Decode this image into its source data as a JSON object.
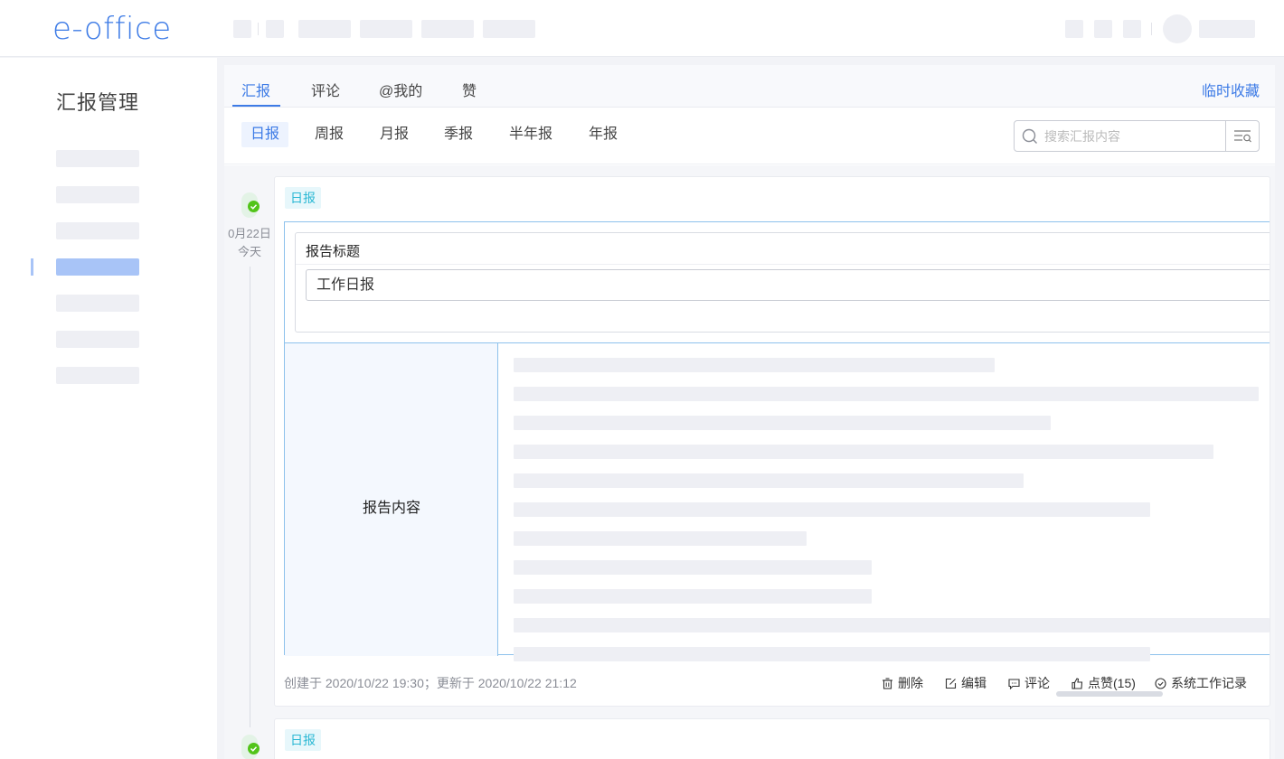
{
  "header": {
    "logo_text": "e-office"
  },
  "sidebar": {
    "title": "汇报管理"
  },
  "tabs": [
    {
      "label": "汇报"
    },
    {
      "label": "评论"
    },
    {
      "label": "@我的"
    },
    {
      "label": "赞"
    }
  ],
  "fav_link": "临时收藏",
  "subtabs": [
    {
      "label": "日报"
    },
    {
      "label": "周报"
    },
    {
      "label": "月报"
    },
    {
      "label": "季报"
    },
    {
      "label": "半年报"
    },
    {
      "label": "年报"
    }
  ],
  "search": {
    "placeholder": "搜索汇报内容"
  },
  "timeline": {
    "date": "0月22日",
    "day": "今天"
  },
  "report": {
    "tag": "日报",
    "title_label": "报告标题",
    "title_value": "工作日报",
    "content_label": "报告内容",
    "meta": "创建于 2020/10/22 19:30；更新于 2020/10/22 21:12",
    "actions": {
      "delete": "删除",
      "edit": "编辑",
      "comment": "评论",
      "like": "点赞(15)",
      "log": "系统工作记录"
    }
  },
  "report2": {
    "tag": "日报"
  },
  "colors": {
    "accent": "#3d7be6",
    "tag": "#2bb8d4",
    "success": "#52c41a"
  }
}
